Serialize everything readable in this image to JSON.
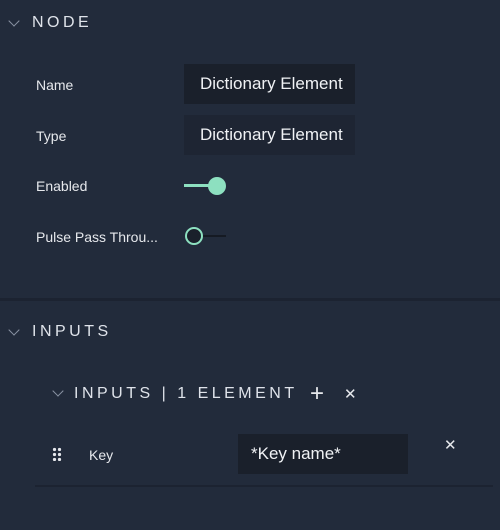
{
  "node": {
    "title": "NODE",
    "fields": [
      {
        "label": "Name",
        "value": "Dictionary Element"
      },
      {
        "label": "Type",
        "value": "Dictionary Element"
      }
    ],
    "enabled": {
      "label": "Enabled",
      "on": true
    },
    "pulse": {
      "label": "Pulse Pass Throu...",
      "on": false
    }
  },
  "inputs": {
    "title": "INPUTS",
    "group": {
      "title": "INPUTS | 1 ELEMENT",
      "add": "+",
      "remove": "✕",
      "item": {
        "label": "Key",
        "placeholder": "*Key name*",
        "remove": "✕"
      }
    }
  },
  "colors": {
    "accent": "#8de0c0"
  }
}
